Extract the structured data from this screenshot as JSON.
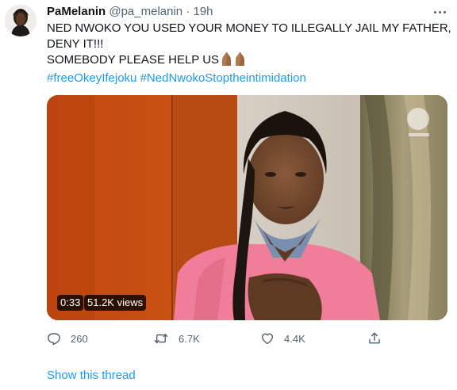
{
  "tweet": {
    "author": {
      "name": "PaMelanin",
      "handle": "@pa_melanin",
      "separator": "·",
      "time": "19h"
    },
    "text_lines": [
      "NED NWOKO YOU USED YOUR MONEY TO ILLEGALLY JAIL MY FATHER,",
      "DENY IT!!!",
      "SOMEBODY PLEASE HELP US"
    ],
    "hashtags": [
      "#freeOkeyIfejoku",
      "#NedNwokoStoptheintimidation"
    ],
    "emoji": [
      "praying-hands",
      "praying-hands"
    ],
    "media": {
      "type": "video",
      "duration": "0:33",
      "views": "51.2K views",
      "watermark": "KINEMASTER"
    },
    "actions": {
      "reply_count": "260",
      "retweet_count": "6.7K",
      "like_count": "4.4K"
    },
    "show_thread_label": "Show this thread"
  },
  "icons": {
    "reply": "speech-bubble-icon",
    "retweet": "retweet-arrows-icon",
    "like": "heart-outline-icon",
    "share": "share-upload-icon",
    "more": "three-dots-icon"
  },
  "colors": {
    "link": "#1d9bf0",
    "secondary_text": "#536471",
    "primary_text": "#0f1419"
  }
}
